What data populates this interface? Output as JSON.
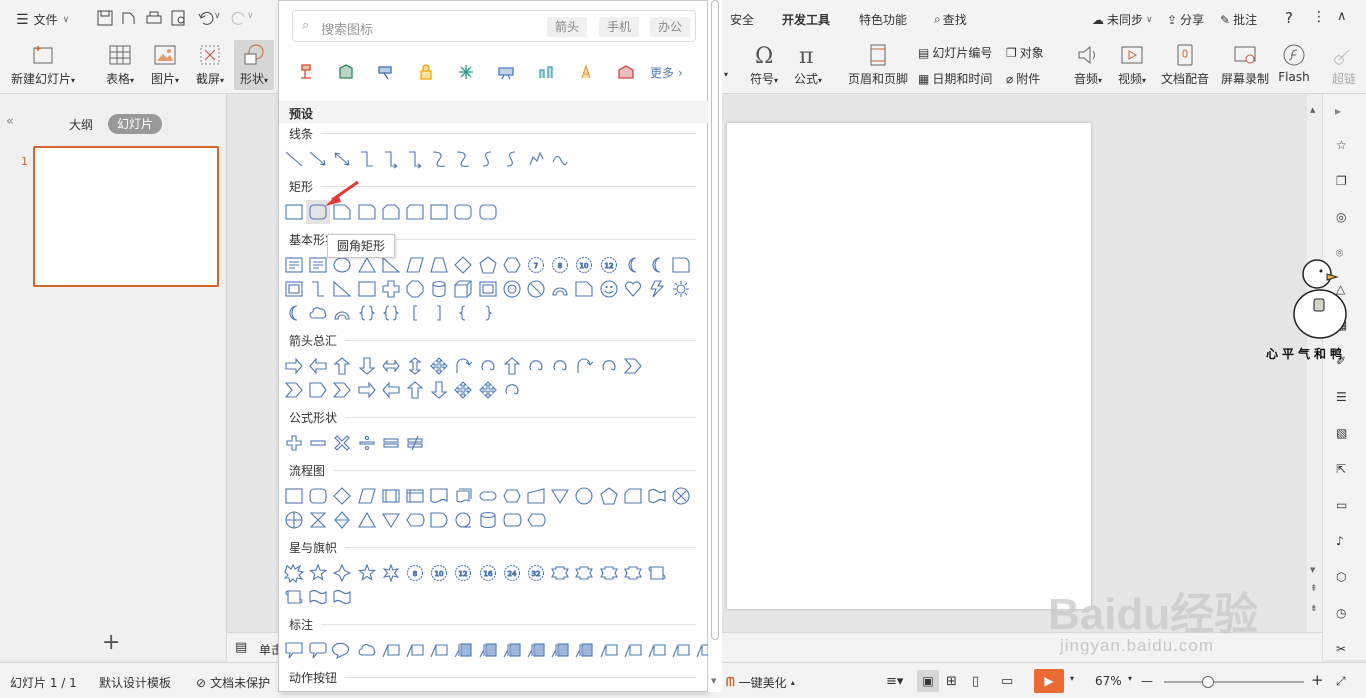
{
  "menubar": {
    "file_label": "文件",
    "tabs": [
      "安全",
      "开发工具",
      "特色功能"
    ],
    "search_label": "查找",
    "sync_label": "未同步",
    "share_label": "分享",
    "comment_label": "批注"
  },
  "ribbon": {
    "left_buttons": [
      {
        "label": "新建幻灯片"
      },
      {
        "label": "表格"
      },
      {
        "label": "图片"
      },
      {
        "label": "截屏"
      },
      {
        "label": "形状"
      }
    ],
    "right_buttons": [
      {
        "label": "符号"
      },
      {
        "label": "公式"
      },
      {
        "label": "页眉和页脚"
      },
      {
        "label": "音频"
      },
      {
        "label": "视频"
      },
      {
        "label": "文档配音"
      },
      {
        "label": "屏幕录制"
      },
      {
        "label": "Flash"
      },
      {
        "label": "超链"
      }
    ],
    "small_buttons": {
      "slide_number": "幻灯片编号",
      "object": "对象",
      "date_time": "日期和时间",
      "attachment": "附件"
    }
  },
  "left_panel": {
    "tab_outline": "大纲",
    "tab_slides": "幻灯片",
    "slide_number": "1",
    "add_symbol": "+"
  },
  "notes": {
    "label": "单击"
  },
  "shapes_panel": {
    "search_placeholder": "搜索图标",
    "tags": [
      "箭头",
      "手机",
      "办公"
    ],
    "more_label": "更多",
    "preset_label": "预设",
    "categories": {
      "lines": "线条",
      "rectangles": "矩形",
      "basic": "基本形状",
      "arrows": "箭头总汇",
      "equation": "公式形状",
      "flowchart": "流程图",
      "stars": "星与旗帜",
      "callouts": "标注",
      "action": "动作按钮"
    },
    "tooltip": "圆角矩形",
    "icon_colors": [
      "#d84a2c",
      "#2e8b57",
      "#3a6fb7",
      "#f0a500",
      "#2a9d8f",
      "#4c7ec9",
      "#3aa0b8",
      "#e9a23b",
      "#d04848"
    ]
  },
  "watermark": {
    "duck_caption": "心平气和鸭",
    "baidu_text": "Baidu经验",
    "url": "jingyan.baidu.com"
  },
  "statusbar": {
    "slide_counter": "幻灯片 1 / 1",
    "template": "默认设计模板",
    "protection": "文档未保护",
    "beautify": "一键美化",
    "zoom": "67%",
    "zoom_minus": "—",
    "zoom_plus": "+"
  },
  "accent_color": "#d0662b",
  "shape_color": "#4d78b4"
}
